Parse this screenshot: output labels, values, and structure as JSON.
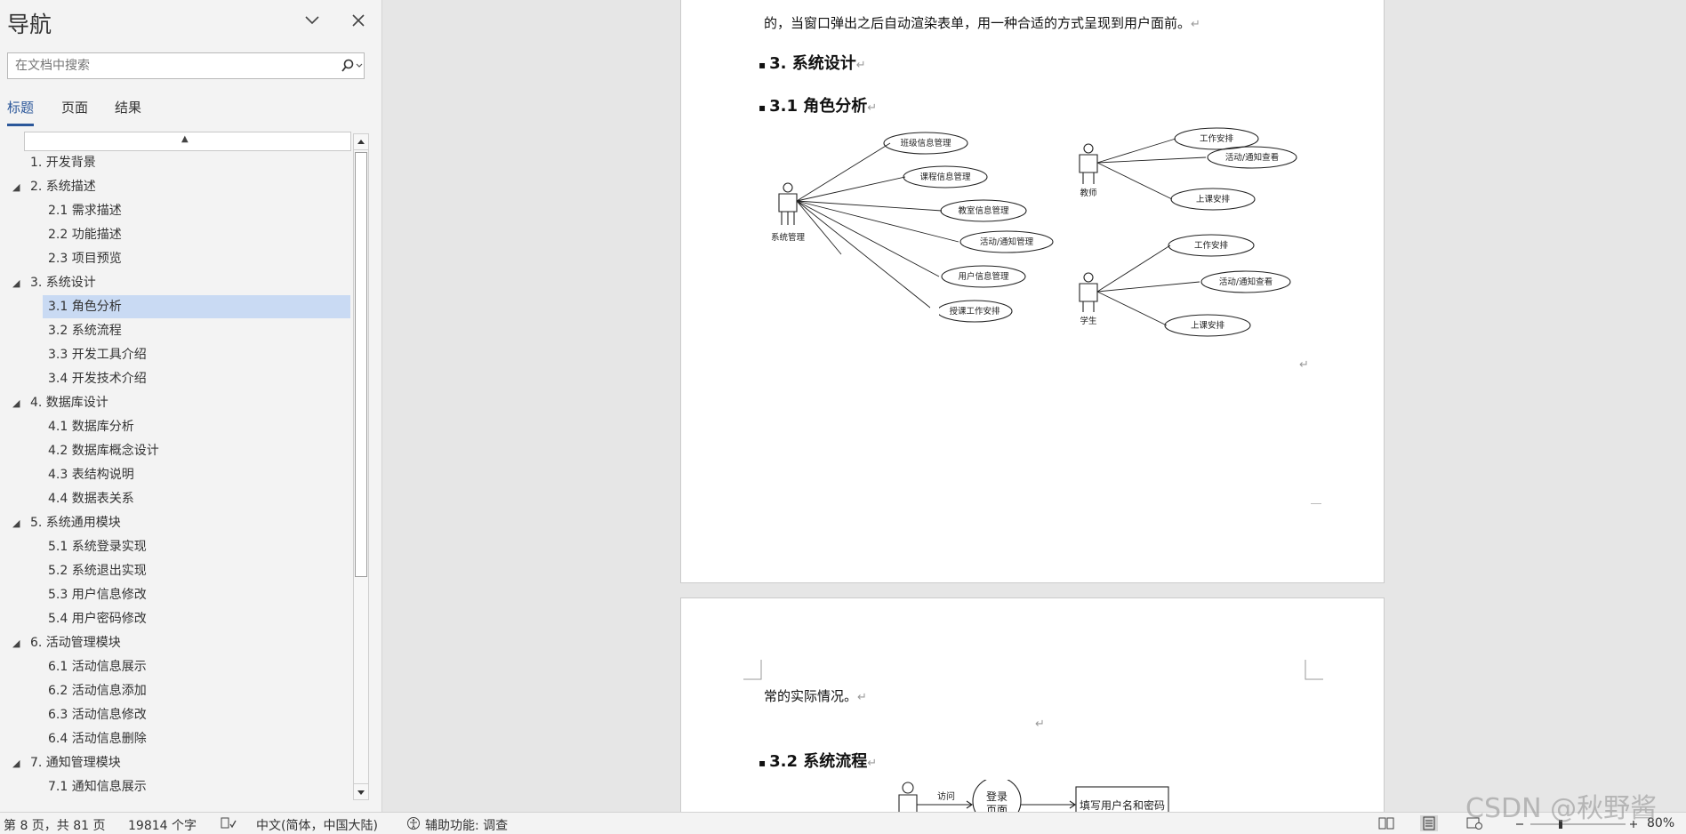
{
  "nav": {
    "title": "导航",
    "search_placeholder": "在文档中搜索",
    "tabs": [
      "标题",
      "页面",
      "结果"
    ],
    "outline": [
      {
        "label": "1. 开发背景",
        "level": 1,
        "expandable": false
      },
      {
        "label": "2. 系统描述",
        "level": 1,
        "expandable": true
      },
      {
        "label": "2.1 需求描述",
        "level": 2
      },
      {
        "label": "2.2 功能描述",
        "level": 2
      },
      {
        "label": "2.3 项目预览",
        "level": 2
      },
      {
        "label": "3. 系统设计",
        "level": 1,
        "expandable": true
      },
      {
        "label": "3.1 角色分析",
        "level": 2,
        "selected": true
      },
      {
        "label": "3.2 系统流程",
        "level": 2
      },
      {
        "label": "3.3 开发工具介绍",
        "level": 2
      },
      {
        "label": "3.4 开发技术介绍",
        "level": 2
      },
      {
        "label": "4. 数据库设计",
        "level": 1,
        "expandable": true
      },
      {
        "label": "4.1 数据库分析",
        "level": 2
      },
      {
        "label": "4.2 数据库概念设计",
        "level": 2
      },
      {
        "label": "4.3 表结构说明",
        "level": 2
      },
      {
        "label": "4.4 数据表关系",
        "level": 2
      },
      {
        "label": "5. 系统通用模块",
        "level": 1,
        "expandable": true
      },
      {
        "label": "5.1 系统登录实现",
        "level": 2
      },
      {
        "label": "5.2 系统退出实现",
        "level": 2
      },
      {
        "label": "5.3 用户信息修改",
        "level": 2
      },
      {
        "label": "5.4 用户密码修改",
        "level": 2
      },
      {
        "label": "6. 活动管理模块",
        "level": 1,
        "expandable": true
      },
      {
        "label": "6.1 活动信息展示",
        "level": 2
      },
      {
        "label": "6.2 活动信息添加",
        "level": 2
      },
      {
        "label": "6.3 活动信息修改",
        "level": 2
      },
      {
        "label": "6.4 活动信息删除",
        "level": 2
      },
      {
        "label": "7. 通知管理模块",
        "level": 1,
        "expandable": true
      },
      {
        "label": "7.1 通知信息展示",
        "level": 2
      }
    ]
  },
  "document": {
    "page1_line": "的，当窗口弹出之后自动渲染表单，用一种合适的方式呈现到用户面前。",
    "heading_3": "3.  系统设计",
    "heading_3_1": "3.1  角色分析",
    "diagram": {
      "admin": {
        "label": "系统管理",
        "use_cases": [
          "班级信息管理",
          "课程信息管理",
          "教室信息管理",
          "活动/通知管理",
          "用户信息管理",
          "授课工作安排"
        ]
      },
      "teacher": {
        "label": "教师",
        "use_cases": [
          "工作安排",
          "活动/通知查看",
          "上课安排"
        ]
      },
      "student": {
        "label": "学生",
        "use_cases": [
          "工作安排",
          "活动/通知查看",
          "上课安排"
        ]
      }
    },
    "page2_line": "常的实际情况。",
    "heading_3_2": "3.2  系统流程",
    "flow": {
      "edge_label": "访问",
      "login_line1": "登录",
      "login_line2": "页面",
      "box_text": "填写用户名和密码"
    },
    "para_mark": "↵"
  },
  "status": {
    "page": "第 8 页，共 81 页",
    "words": "19814 个字",
    "language": "中文(简体，中国大陆)",
    "accessibility": "辅助功能: 调查",
    "zoom": "80%"
  },
  "watermark": "CSDN @秋野酱"
}
